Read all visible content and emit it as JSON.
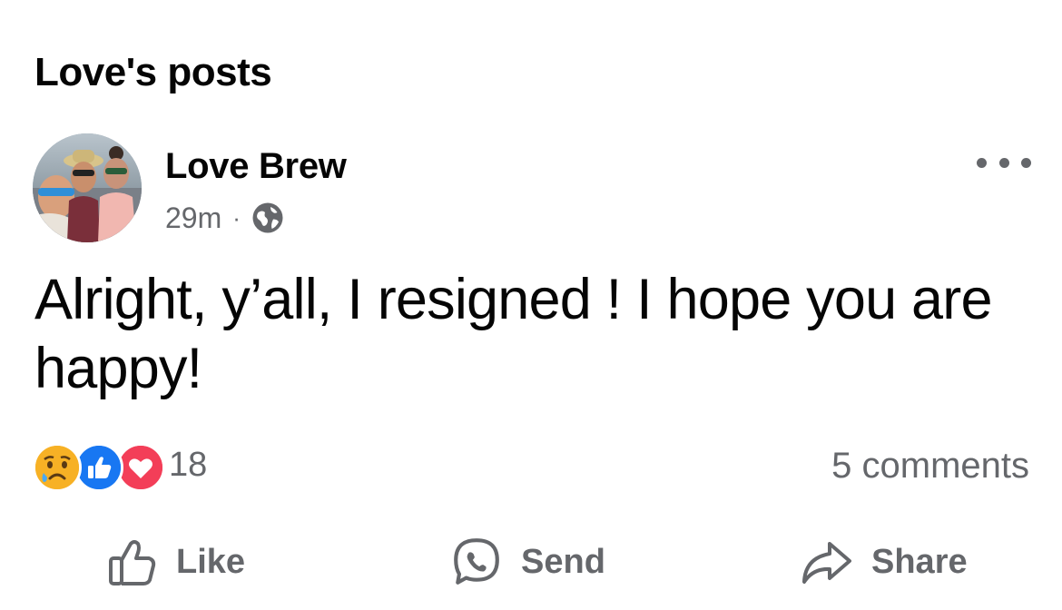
{
  "section": {
    "title": "Love's posts"
  },
  "post": {
    "author": "Love Brew",
    "time": "29m",
    "separator": "·",
    "privacy_icon": "globe-icon",
    "text": "Alright, y’all, I resigned ! I hope you are happy!",
    "reactions": {
      "icons": [
        "sad-icon",
        "like-icon",
        "love-icon"
      ],
      "count": "18"
    },
    "comments": "5 comments"
  },
  "actions": {
    "like": "Like",
    "send": "Send",
    "share": "Share"
  },
  "colors": {
    "text": "#050505",
    "secondary": "#65676b",
    "like_blue": "#1877f2",
    "love_red": "#f33e58",
    "sad_yellow": "#f7b125"
  }
}
